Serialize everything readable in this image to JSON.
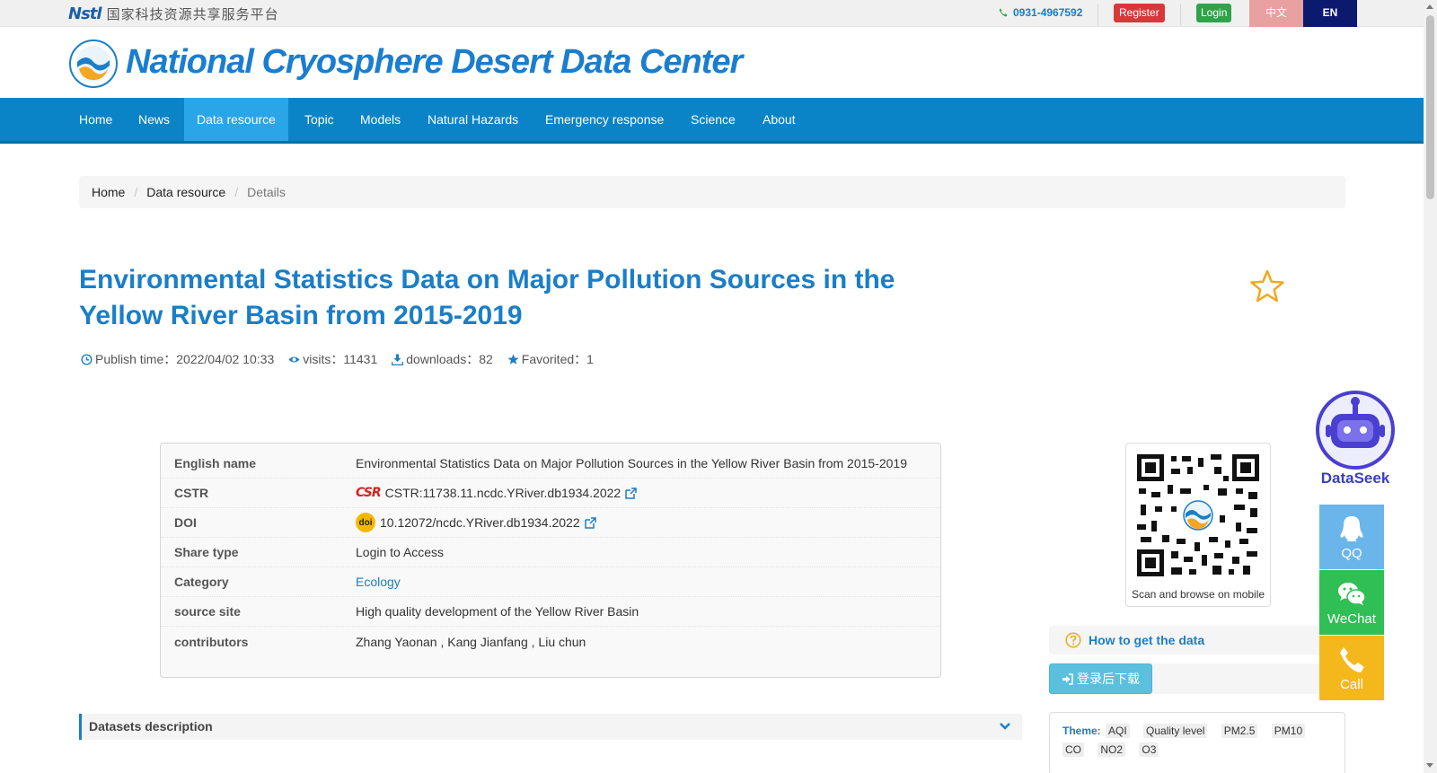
{
  "topbar": {
    "platform_text": "国家科技资源共享服务平台",
    "platform_mark": "Nstl",
    "phone": "0931-4967592",
    "register_label": "Register",
    "login_label": "Login",
    "lang_zh": "中文",
    "lang_en": "EN"
  },
  "header": {
    "site_title": "National Cryosphere Desert Data Center"
  },
  "nav": {
    "items": [
      "Home",
      "News",
      "Data resource",
      "Topic",
      "Models",
      "Natural Hazards",
      "Emergency response",
      "Science",
      "About"
    ],
    "active": "Data resource"
  },
  "breadcrumb": {
    "home": "Home",
    "section": "Data resource",
    "current": "Details"
  },
  "dataset": {
    "title": "Environmental Statistics Data on Major Pollution Sources in the Yellow River Basin from 2015-2019",
    "publish_time": "Publish time：2022/04/02 10:33",
    "visits": "visits：11431",
    "downloads": "downloads：82",
    "favorited": "Favorited：1"
  },
  "info": {
    "rows": [
      {
        "label": "English name",
        "value": "Environmental Statistics Data on Major Pollution Sources in the Yellow River Basin from 2015-2019"
      },
      {
        "label": "CSTR",
        "value": "CSTR:11738.11.ncdc.YRiver.db1934.2022"
      },
      {
        "label": "DOI",
        "value": "10.12072/ncdc.YRiver.db1934.2022"
      },
      {
        "label": "Share type",
        "value": "Login to Access"
      },
      {
        "label": "Category",
        "value": "Ecology"
      },
      {
        "label": "source site",
        "value": "High quality development of the Yellow River Basin"
      },
      {
        "label": "contributors",
        "value": "Zhang Yaonan , Kang Jianfang , Liu chun"
      }
    ],
    "cstr_logo": "CSR",
    "doi_logo": "doi"
  },
  "datasets_description": "Datasets description",
  "sidebar": {
    "qr_caption": "Scan and browse on mobile",
    "howto_label": "How to get the data",
    "download_label": "登录后下载",
    "theme_label": "Theme:",
    "theme_tags": [
      "AQI",
      "Quality level",
      "PM2.5",
      "PM10",
      "CO",
      "NO2",
      "O3"
    ]
  },
  "floating": {
    "dataseek": "DataSeek",
    "qq": "QQ",
    "wechat": "WeChat",
    "call": "Call"
  },
  "colors": {
    "primary": "#1a7ec8",
    "nav_bg": "#0a84c6",
    "nav_active": "#2aa6e8",
    "register": "#d9383a",
    "login": "#2fa34a"
  }
}
